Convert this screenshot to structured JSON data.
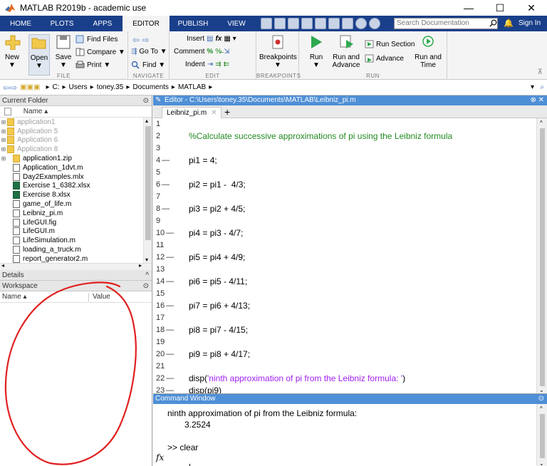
{
  "window": {
    "title": "MATLAB R2019b - academic use",
    "minimize": "—",
    "maximize": "☐",
    "close": "✕"
  },
  "ribbon_tabs": [
    "HOME",
    "PLOTS",
    "APPS",
    "EDITOR",
    "PUBLISH",
    "VIEW"
  ],
  "active_tab": "EDITOR",
  "search": {
    "placeholder": "Search Documentation"
  },
  "signin": "Sign In",
  "ribbon": {
    "file": {
      "label": "FILE",
      "new": "New",
      "open": "Open",
      "save": "Save",
      "find_files": "Find Files",
      "compare": "Compare ▼",
      "print": "Print ▼"
    },
    "navigate": {
      "label": "NAVIGATE",
      "go_to": "Go To ▼",
      "find": "Find ▼"
    },
    "edit": {
      "label": "EDIT",
      "insert": "Insert",
      "comment": "Comment",
      "indent": "Indent"
    },
    "breakpoints": {
      "label": "BREAKPOINTS",
      "breakpoints": "Breakpoints"
    },
    "run": {
      "label": "RUN",
      "run": "Run",
      "run_and_advance": "Run and Advance",
      "run_section": "Run Section",
      "advance": "Advance",
      "run_and_time": "Run and Time"
    }
  },
  "path": [
    "C:",
    "Users",
    "toney.35",
    "Documents",
    "MATLAB"
  ],
  "current_folder": {
    "title": "Current Folder",
    "column": "Name ▴",
    "files": [
      {
        "name": "application1",
        "type": "folder",
        "expand": "⊞",
        "dim": true
      },
      {
        "name": "Application 5",
        "type": "folder",
        "expand": "⊞",
        "dim": true
      },
      {
        "name": "Application 6",
        "type": "folder",
        "expand": "⊞",
        "dim": true
      },
      {
        "name": "Application 8",
        "type": "folder",
        "expand": "⊞",
        "dim": true
      },
      {
        "name": "application1.zip",
        "type": "zip",
        "expand": "⊞",
        "dim": false
      },
      {
        "name": "Application_1dvt.m",
        "type": "m",
        "expand": "",
        "dim": false
      },
      {
        "name": "Day2Examples.mlx",
        "type": "m",
        "expand": "",
        "dim": false
      },
      {
        "name": "Exercise 1_6382.xlsx",
        "type": "xls",
        "expand": "",
        "dim": false
      },
      {
        "name": "Exercise 8.xlsx",
        "type": "xls",
        "expand": "",
        "dim": false
      },
      {
        "name": "game_of_life.m",
        "type": "m",
        "expand": "",
        "dim": false
      },
      {
        "name": "Leibniz_pi.m",
        "type": "m",
        "expand": "",
        "dim": false
      },
      {
        "name": "LifeGUI.fig",
        "type": "m",
        "expand": "",
        "dim": false
      },
      {
        "name": "LifeGUI.m",
        "type": "m",
        "expand": "",
        "dim": false
      },
      {
        "name": "LifeSimulation.m",
        "type": "m",
        "expand": "",
        "dim": false
      },
      {
        "name": "loading_a_truck.m",
        "type": "m",
        "expand": "",
        "dim": false
      },
      {
        "name": "report_generator2.m",
        "type": "m",
        "expand": "",
        "dim": false
      }
    ]
  },
  "details": {
    "title": "Details"
  },
  "workspace": {
    "title": "Workspace",
    "col_name": "Name ▴",
    "col_value": "Value"
  },
  "editor": {
    "title": "Editor - C:\\Users\\toney.35\\Documents\\MATLAB\\Leibniz_pi.m",
    "tab": "Leibniz_pi.m",
    "tab_close": "✕",
    "lines": [
      {
        "n": "1",
        "mark": "",
        "text": "",
        "kind": "code"
      },
      {
        "n": "2",
        "mark": "",
        "text": "%Calculate successive approximations of pi using the Leibniz formula",
        "kind": "comment"
      },
      {
        "n": "3",
        "mark": "",
        "text": "",
        "kind": "code"
      },
      {
        "n": "4",
        "mark": "—",
        "text": "pi1 = 4;",
        "kind": "code"
      },
      {
        "n": "5",
        "mark": "",
        "text": "",
        "kind": "code"
      },
      {
        "n": "6",
        "mark": "—",
        "text": "pi2 = pi1 -  4/3;",
        "kind": "code"
      },
      {
        "n": "7",
        "mark": "",
        "text": "",
        "kind": "code"
      },
      {
        "n": "8",
        "mark": "—",
        "text": "pi3 = pi2 + 4/5;",
        "kind": "code"
      },
      {
        "n": "9",
        "mark": "",
        "text": "",
        "kind": "code"
      },
      {
        "n": "10",
        "mark": "—",
        "text": "pi4 = pi3 - 4/7;",
        "kind": "code"
      },
      {
        "n": "11",
        "mark": "",
        "text": "",
        "kind": "code"
      },
      {
        "n": "12",
        "mark": "—",
        "text": "pi5 = pi4 + 4/9;",
        "kind": "code"
      },
      {
        "n": "13",
        "mark": "",
        "text": "",
        "kind": "code"
      },
      {
        "n": "14",
        "mark": "—",
        "text": "pi6 = pi5 - 4/11;",
        "kind": "code"
      },
      {
        "n": "15",
        "mark": "",
        "text": "",
        "kind": "code"
      },
      {
        "n": "16",
        "mark": "—",
        "text": "pi7 = pi6 + 4/13;",
        "kind": "code"
      },
      {
        "n": "17",
        "mark": "",
        "text": "",
        "kind": "code"
      },
      {
        "n": "18",
        "mark": "—",
        "text": "pi8 = pi7 - 4/15;",
        "kind": "code"
      },
      {
        "n": "19",
        "mark": "",
        "text": "",
        "kind": "code"
      },
      {
        "n": "20",
        "mark": "—",
        "text": "pi9 = pi8 + 4/17;",
        "kind": "code"
      },
      {
        "n": "21",
        "mark": "",
        "text": "",
        "kind": "code"
      },
      {
        "n": "22",
        "mark": "—",
        "text": "disp(",
        "kind": "disp",
        "str": "'ninth approximation of pi from the Leibniz formula: '",
        "tail": ")"
      },
      {
        "n": "23",
        "mark": "—",
        "text": "disp(pi9)",
        "kind": "code"
      }
    ]
  },
  "command_window": {
    "title": "Command Window",
    "output_line1": "ninth approximation of pi from the Leibniz formula:",
    "output_line2": "3.2524",
    "prompt_line": ">> clear",
    "prompt": ">>",
    "fx": "fx"
  },
  "colors": {
    "tabstrip": "#1a3f8a",
    "panel_header": "#4f8fd6",
    "comment": "#228b22",
    "string": "#a020f0",
    "annotation": "#e02020"
  }
}
